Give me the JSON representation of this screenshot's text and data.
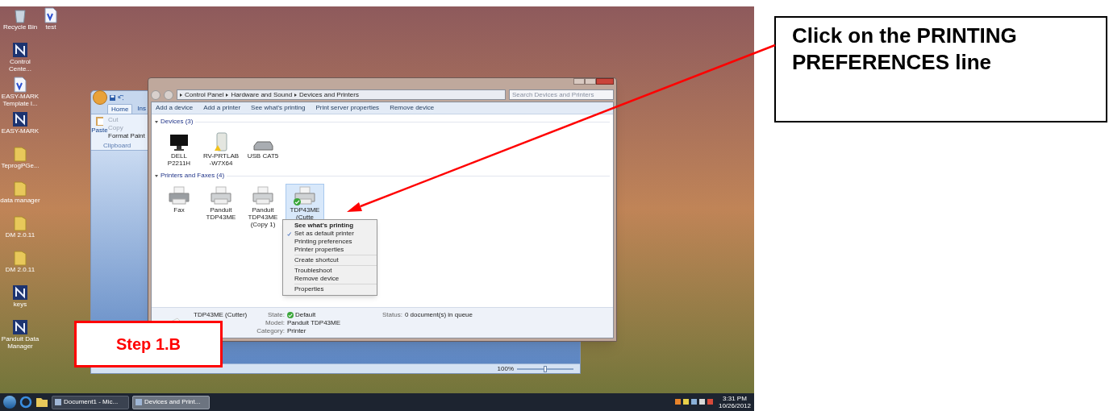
{
  "desktop": {
    "icons": [
      {
        "label": "Recycle Bin",
        "kind": "bin"
      },
      {
        "label": "test",
        "kind": "doc"
      },
      {
        "label": "Control Cente...",
        "kind": "app"
      },
      {
        "label": "EASY-MARK Template l...",
        "kind": "doc"
      },
      {
        "label": "EASY-MARK",
        "kind": "app"
      },
      {
        "label": "TeprogPGe...",
        "kind": "folder"
      },
      {
        "label": "data manager",
        "kind": "folder"
      },
      {
        "label": "DM 2.0.11",
        "kind": "folder"
      },
      {
        "label": "DM 2.0.11",
        "kind": "folder"
      },
      {
        "label": "keys",
        "kind": "app"
      },
      {
        "label": "Panduit Data Manager",
        "kind": "app"
      }
    ]
  },
  "word_window": {
    "tabs": [
      {
        "label": "Home",
        "selected": true
      },
      {
        "label": "Ins",
        "selected": false
      }
    ],
    "paste": "Paste",
    "clipboard_items": [
      "Cut",
      "Copy",
      "Format Paint"
    ],
    "group": "Clipboard",
    "zoom": "100%",
    "zoom_slider": {
      "level": 0.5
    }
  },
  "explorer": {
    "breadcrumb": [
      "Control Panel",
      "Hardware and Sound",
      "Devices and Printers"
    ],
    "search": {
      "placeholder": "Search Devices and Printers"
    },
    "toolbar": [
      "Add a device",
      "Add a printer",
      "See what's printing",
      "Print server properties",
      "Remove device"
    ],
    "groups": [
      {
        "title": "Devices (3)",
        "items": [
          {
            "label": "DELL P2211H",
            "kind": "monitor",
            "selected": false,
            "default": false
          },
          {
            "label": "RV-PRTLAB -W7X64",
            "kind": "drive",
            "selected": false,
            "default": false
          },
          {
            "label": "USB CAT5",
            "kind": "hub",
            "selected": false,
            "default": false
          }
        ]
      },
      {
        "title": "Printers and Faxes (4)",
        "items": [
          {
            "label": "Fax",
            "kind": "fax",
            "selected": false,
            "default": false
          },
          {
            "label": "Panduit TDP43ME",
            "kind": "printer",
            "selected": false,
            "default": false
          },
          {
            "label": "Panduit TDP43ME (Copy 1)",
            "kind": "printer",
            "selected": false,
            "default": false
          },
          {
            "label": "TDP43ME (Cutte",
            "kind": "printer",
            "selected": true,
            "default": true
          }
        ]
      }
    ],
    "context_menu": [
      {
        "kind": "item",
        "label": "See what's printing",
        "bold": true,
        "checked": false
      },
      {
        "kind": "item",
        "label": "Set as default printer",
        "bold": false,
        "checked": true
      },
      {
        "kind": "item",
        "label": "Printing preferences",
        "bold": false,
        "checked": false
      },
      {
        "kind": "item",
        "label": "Printer properties",
        "bold": false,
        "checked": false
      },
      {
        "kind": "separator"
      },
      {
        "kind": "item",
        "label": "Create shortcut",
        "bold": false,
        "checked": false
      },
      {
        "kind": "separator"
      },
      {
        "kind": "item",
        "label": "Troubleshoot",
        "bold": false,
        "checked": false
      },
      {
        "kind": "item",
        "label": "Remove device",
        "bold": false,
        "checked": false
      },
      {
        "kind": "separator"
      },
      {
        "kind": "item",
        "label": "Properties",
        "bold": false,
        "checked": false
      }
    ],
    "details": {
      "name": "TDP43ME (Cutter)",
      "fields": [
        {
          "label": "State:",
          "value": "Default"
        },
        {
          "label": "Model:",
          "value": "Panduit TDP43ME"
        },
        {
          "label": "Category:",
          "value": "Printer"
        }
      ],
      "status": {
        "label": "Status:",
        "value": "0 document(s) in queue"
      }
    }
  },
  "taskbar": {
    "buttons": [
      {
        "label": "Document1 - Mic...",
        "selected": false
      },
      {
        "label": "Devices and Print...",
        "selected": true
      }
    ],
    "time": "3:31 PM",
    "date": "10/26/2012"
  },
  "annotations": {
    "callout": "Click on the PRINTING PREFERENCES line",
    "step": "Step 1.B"
  }
}
